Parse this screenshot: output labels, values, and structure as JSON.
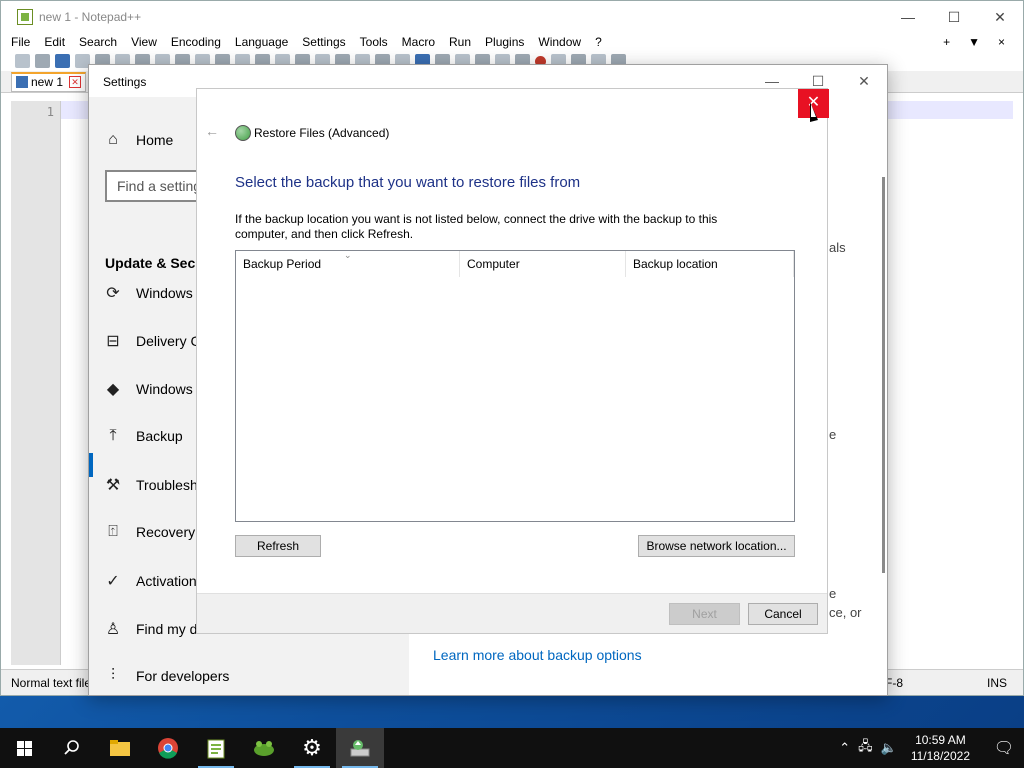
{
  "notepad": {
    "title": "new 1 - Notepad++",
    "menu": [
      "File",
      "Edit",
      "Search",
      "View",
      "Encoding",
      "Language",
      "Settings",
      "Tools",
      "Macro",
      "Run",
      "Plugins",
      "Window",
      "?"
    ],
    "menu_right": [
      "+",
      "▼",
      "×"
    ],
    "tab": "new 1",
    "line_number": "1",
    "status_left": "Normal text file",
    "status_enc": "F-8",
    "status_ins": "INS"
  },
  "settings": {
    "title": "Settings",
    "home": "Home",
    "search_placeholder": "Find a setting",
    "section": "Update & Secu",
    "nav": [
      {
        "label": "Windows",
        "icon": "refresh-icon"
      },
      {
        "label": "Delivery C",
        "icon": "delivery-icon"
      },
      {
        "label": "Windows",
        "icon": "shield-icon"
      },
      {
        "label": "Backup",
        "icon": "backup-arrow-icon"
      },
      {
        "label": "Troublesh",
        "icon": "wrench-icon"
      },
      {
        "label": "Recovery",
        "icon": "recovery-icon"
      },
      {
        "label": "Activation",
        "icon": "check-circle-icon"
      },
      {
        "label": "Find my d",
        "icon": "person-pin-icon"
      },
      {
        "label": "For developers",
        "icon": "developer-icon"
      }
    ],
    "right_fragments": [
      "als",
      "e",
      "e",
      "ce, or"
    ],
    "learn_link": "Learn more about backup options"
  },
  "dialog": {
    "title": "Restore Files (Advanced)",
    "heading": "Select the backup that you want to restore files from",
    "description": "If the backup location you want is not listed below, connect the drive with the backup to this computer, and then click Refresh.",
    "columns": [
      "Backup Period",
      "Computer",
      "Backup location"
    ],
    "refresh": "Refresh",
    "browse": "Browse network location...",
    "next": "Next",
    "cancel": "Cancel"
  },
  "taskbar": {
    "time": "10:59 AM",
    "date": "11/18/2022"
  }
}
